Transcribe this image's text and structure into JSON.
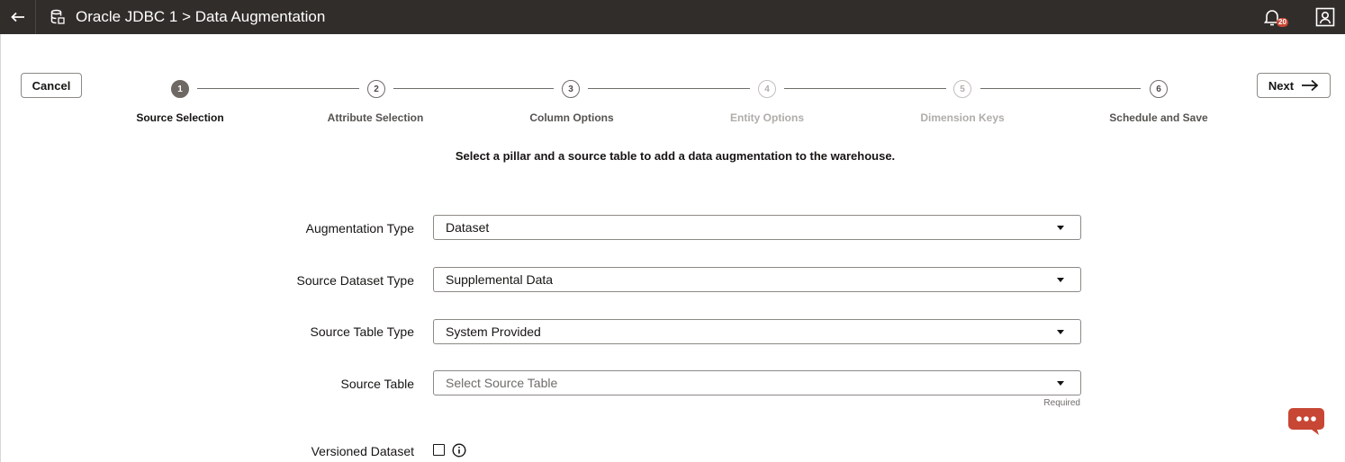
{
  "header": {
    "title": "Oracle JDBC 1 > Data Augmentation",
    "notification_count": "20"
  },
  "actions": {
    "cancel_label": "Cancel",
    "next_label": "Next"
  },
  "steps": [
    {
      "number": "1",
      "label": "Source Selection",
      "state": "active"
    },
    {
      "number": "2",
      "label": "Attribute Selection",
      "state": "enabled"
    },
    {
      "number": "3",
      "label": "Column Options",
      "state": "enabled"
    },
    {
      "number": "4",
      "label": "Entity Options",
      "state": "disabled"
    },
    {
      "number": "5",
      "label": "Dimension Keys",
      "state": "disabled"
    },
    {
      "number": "6",
      "label": "Schedule and Save",
      "state": "enabled"
    }
  ],
  "instruction": "Select a pillar and a source table to add a data augmentation to the warehouse.",
  "form": {
    "augmentation_type": {
      "label": "Augmentation Type",
      "value": "Dataset"
    },
    "source_dataset_type": {
      "label": "Source Dataset Type",
      "value": "Supplemental Data"
    },
    "source_table_type": {
      "label": "Source Table Type",
      "value": "System Provided"
    },
    "source_table": {
      "label": "Source Table",
      "placeholder": "Select Source Table",
      "hint": "Required"
    },
    "versioned_dataset": {
      "label": "Versioned Dataset",
      "checked": false
    }
  },
  "colors": {
    "header_bg": "#312d2a",
    "badge": "#c74634",
    "chat": "#c74634"
  },
  "icons": [
    "back-arrow-icon",
    "database-icon",
    "bell-icon",
    "user-icon",
    "arrow-right-icon",
    "caret-down-icon",
    "info-icon",
    "chat-icon"
  ]
}
